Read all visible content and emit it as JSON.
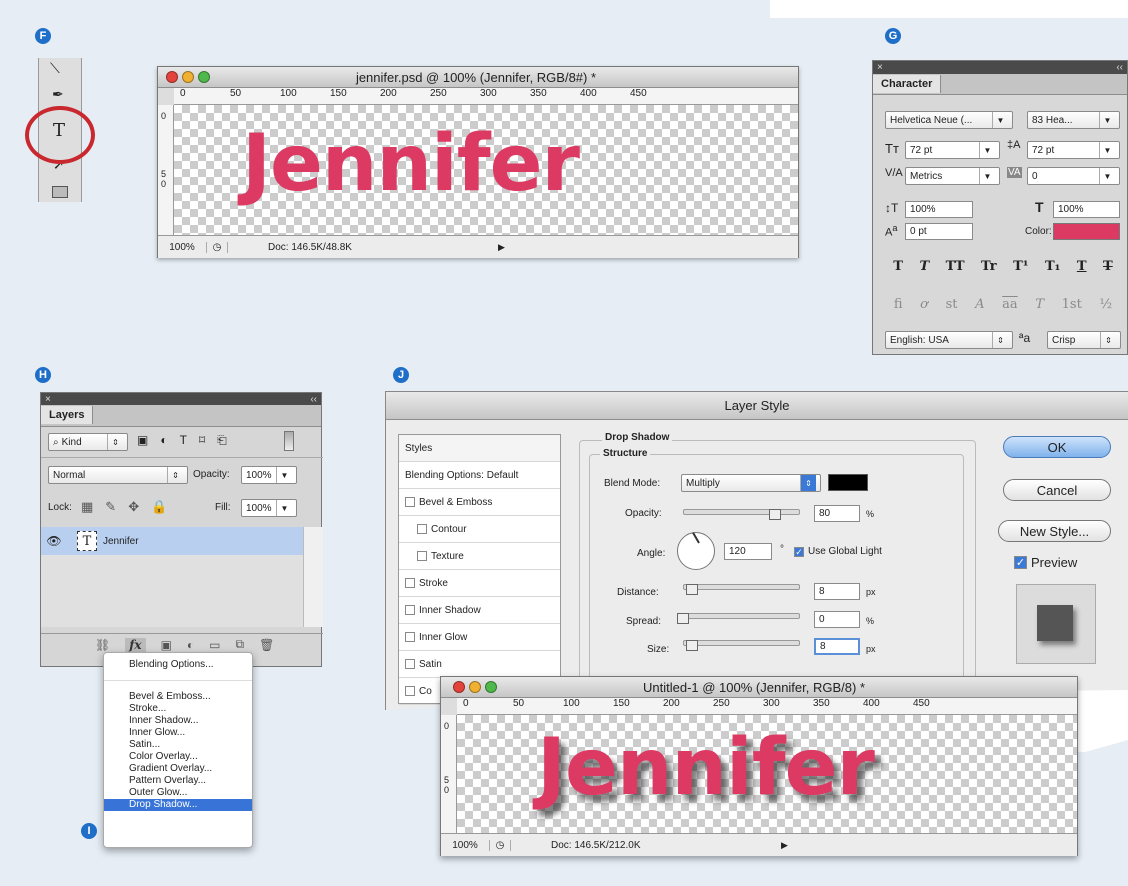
{
  "badges": {
    "f": "F",
    "g": "G",
    "h": "H",
    "i": "I",
    "j": "J"
  },
  "colors": {
    "text_fill": "#dc3a62",
    "accent": "#1f6fc8",
    "selection": "#3874d8"
  },
  "doc1": {
    "title": "jennifer.psd @ 100% (Jennifer, RGB/8#) *",
    "ruler_h": [
      "0",
      "50",
      "100",
      "150",
      "200",
      "250",
      "300",
      "350",
      "400",
      "450"
    ],
    "ruler_v": [
      "0",
      "5",
      "0"
    ],
    "canvas_text": "Jennifer",
    "zoom": "100%",
    "doc_info": "Doc: 146.5K/48.8K"
  },
  "toolbox": {
    "type_tool": "T"
  },
  "character": {
    "tab": "Character",
    "font_family": "Helvetica Neue (...",
    "font_style": "83 Hea...",
    "size": "72 pt",
    "leading": "72 pt",
    "kerning": "Metrics",
    "tracking": "0",
    "vscale": "100%",
    "hscale": "100%",
    "baseline": "0 pt",
    "color_label": "Color:",
    "style_buttons": [
      "T",
      "T",
      "TT",
      "Tr",
      "T¹",
      "T₁",
      "T",
      "T"
    ],
    "ot_buttons": [
      "fi",
      "ơ",
      "st",
      "A",
      "aa",
      "T",
      "1st",
      "½"
    ],
    "language": "English: USA",
    "aa_icon": "ªa",
    "aa_method": "Crisp"
  },
  "layers": {
    "tab": "Layers",
    "kind": "Kind",
    "blend": "Normal",
    "opacity_label": "Opacity:",
    "opacity": "100%",
    "lock_label": "Lock:",
    "fill_label": "Fill:",
    "fill": "100%",
    "layer_name": "Jennifer",
    "fx": "fx"
  },
  "fx_menu": {
    "items": [
      "Blending Options...",
      "Bevel & Emboss...",
      "Stroke...",
      "Inner Shadow...",
      "Inner Glow...",
      "Satin...",
      "Color Overlay...",
      "Gradient Overlay...",
      "Pattern Overlay...",
      "Outer Glow...",
      "Drop Shadow..."
    ],
    "selected": "Drop Shadow..."
  },
  "layer_style": {
    "title": "Layer Style",
    "styles_header": "Styles",
    "blending_default": "Blending Options: Default",
    "styles": [
      "Bevel & Emboss",
      "Contour",
      "Texture",
      "Stroke",
      "Inner Shadow",
      "Inner Glow",
      "Satin",
      "Co"
    ],
    "section": "Drop Shadow",
    "structure": "Structure",
    "blend_mode_label": "Blend Mode:",
    "blend_mode": "Multiply",
    "opacity_label": "Opacity:",
    "opacity": "80",
    "opacity_unit": "%",
    "angle_label": "Angle:",
    "angle": "120",
    "degree": "°",
    "global_light": "Use Global Light",
    "distance_label": "Distance:",
    "distance": "8",
    "distance_unit": "px",
    "spread_label": "Spread:",
    "spread": "0",
    "spread_unit": "%",
    "size_label": "Size:",
    "size": "8",
    "size_unit": "px",
    "ok": "OK",
    "cancel": "Cancel",
    "new_style": "New Style...",
    "preview": "Preview"
  },
  "doc2": {
    "title": "Untitled-1 @ 100% (Jennifer, RGB/8) *",
    "ruler_h": [
      "0",
      "50",
      "100",
      "150",
      "200",
      "250",
      "300",
      "350",
      "400",
      "450"
    ],
    "canvas_text": "Jennifer",
    "zoom": "100%",
    "doc_info": "Doc: 146.5K/212.0K"
  }
}
